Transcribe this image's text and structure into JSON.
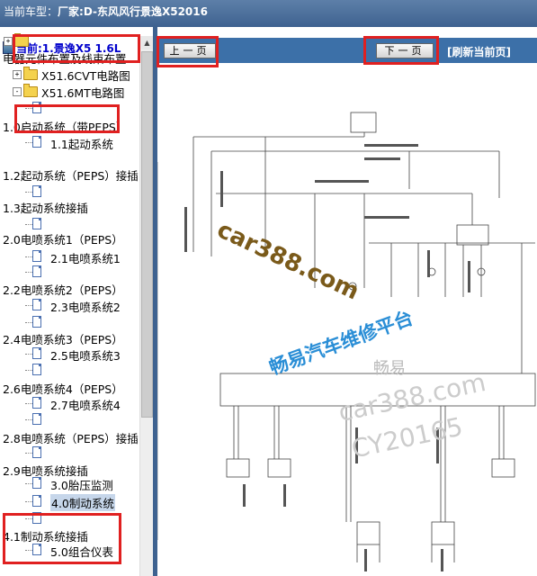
{
  "window": {
    "title_label": "当前车型：",
    "title_value": "厂家:D-东风风行景逸X52016"
  },
  "tree": {
    "root_label": "当前:1.景逸X5 1.6L",
    "items": [
      {
        "label": "",
        "kind": "folder"
      },
      {
        "label": "电器元件布置及线束布置",
        "kind": "text"
      },
      {
        "label": "X51.6CVT电路图",
        "kind": "folder"
      },
      {
        "label": "X51.6MT电路图",
        "kind": "folder"
      },
      {
        "label": "",
        "kind": "doc"
      },
      {
        "label": "1.0启动系统（带PEPS）",
        "kind": "text"
      },
      {
        "label": "1.1起动系统",
        "kind": "doc"
      },
      {
        "label": "1.2起动系统（PEPS）接插",
        "kind": "text"
      },
      {
        "label": "",
        "kind": "doc"
      },
      {
        "label": "1.3起动系统接插",
        "kind": "text"
      },
      {
        "label": "",
        "kind": "doc"
      },
      {
        "label": "2.0电喷系统1（PEPS）",
        "kind": "text"
      },
      {
        "label": "2.1电喷系统1",
        "kind": "doc"
      },
      {
        "label": "",
        "kind": "doc"
      },
      {
        "label": "2.2电喷系统2（PEPS）",
        "kind": "text"
      },
      {
        "label": "2.3电喷系统2",
        "kind": "doc"
      },
      {
        "label": "",
        "kind": "doc"
      },
      {
        "label": "2.4电喷系统3（PEPS）",
        "kind": "text"
      },
      {
        "label": "2.5电喷系统3",
        "kind": "doc"
      },
      {
        "label": "",
        "kind": "doc"
      },
      {
        "label": "2.6电喷系统4（PEPS）",
        "kind": "text"
      },
      {
        "label": "2.7电喷系统4",
        "kind": "doc"
      },
      {
        "label": "",
        "kind": "doc"
      },
      {
        "label": "2.8电喷系统（PEPS）接插",
        "kind": "text"
      },
      {
        "label": "",
        "kind": "doc"
      },
      {
        "label": "2.9电喷系统接插",
        "kind": "text"
      },
      {
        "label": "3.0胎压监测",
        "kind": "doc"
      },
      {
        "label": "4.0制动系统",
        "kind": "doc"
      },
      {
        "label": "",
        "kind": "doc"
      },
      {
        "label": "4.1制动系统接插",
        "kind": "text"
      },
      {
        "label": "5.0组合仪表",
        "kind": "doc"
      }
    ]
  },
  "toolbar": {
    "prev_label": "上一页",
    "next_label": "下一页",
    "refresh_label": "[刷新当前页]"
  },
  "watermarks": {
    "site1": "car388.com",
    "platform": "畅易汽车维修平台",
    "brand": "畅易",
    "site2": "car388.com",
    "code": "CY20165"
  },
  "colors": {
    "title_bg": "#3e6290",
    "toolbar_bg": "#3c70a8",
    "root_text": "#0000cc",
    "highlight_box": "#e02020",
    "selected_bg": "#c6d6ea"
  }
}
